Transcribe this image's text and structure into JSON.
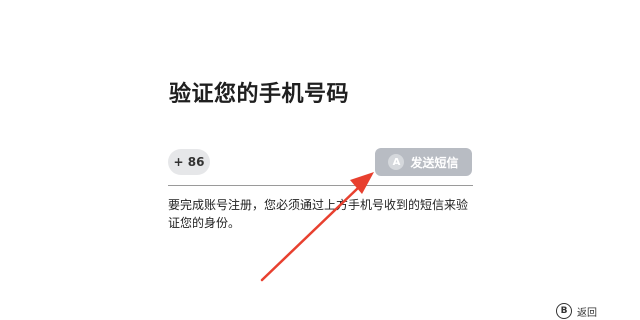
{
  "title": "验证您的手机号码",
  "phone": {
    "country_code": "+ 86",
    "send_button": {
      "glyph": "A",
      "label": "发送短信"
    }
  },
  "instructions": "要完成账号注册，您必须通过上方手机号收到的短信来验证您的身份。",
  "footer": {
    "back_glyph": "B",
    "back_label": "返回"
  },
  "annotation": {
    "arrow_color": "#e8402f",
    "icon": "red-arrow-icon"
  }
}
